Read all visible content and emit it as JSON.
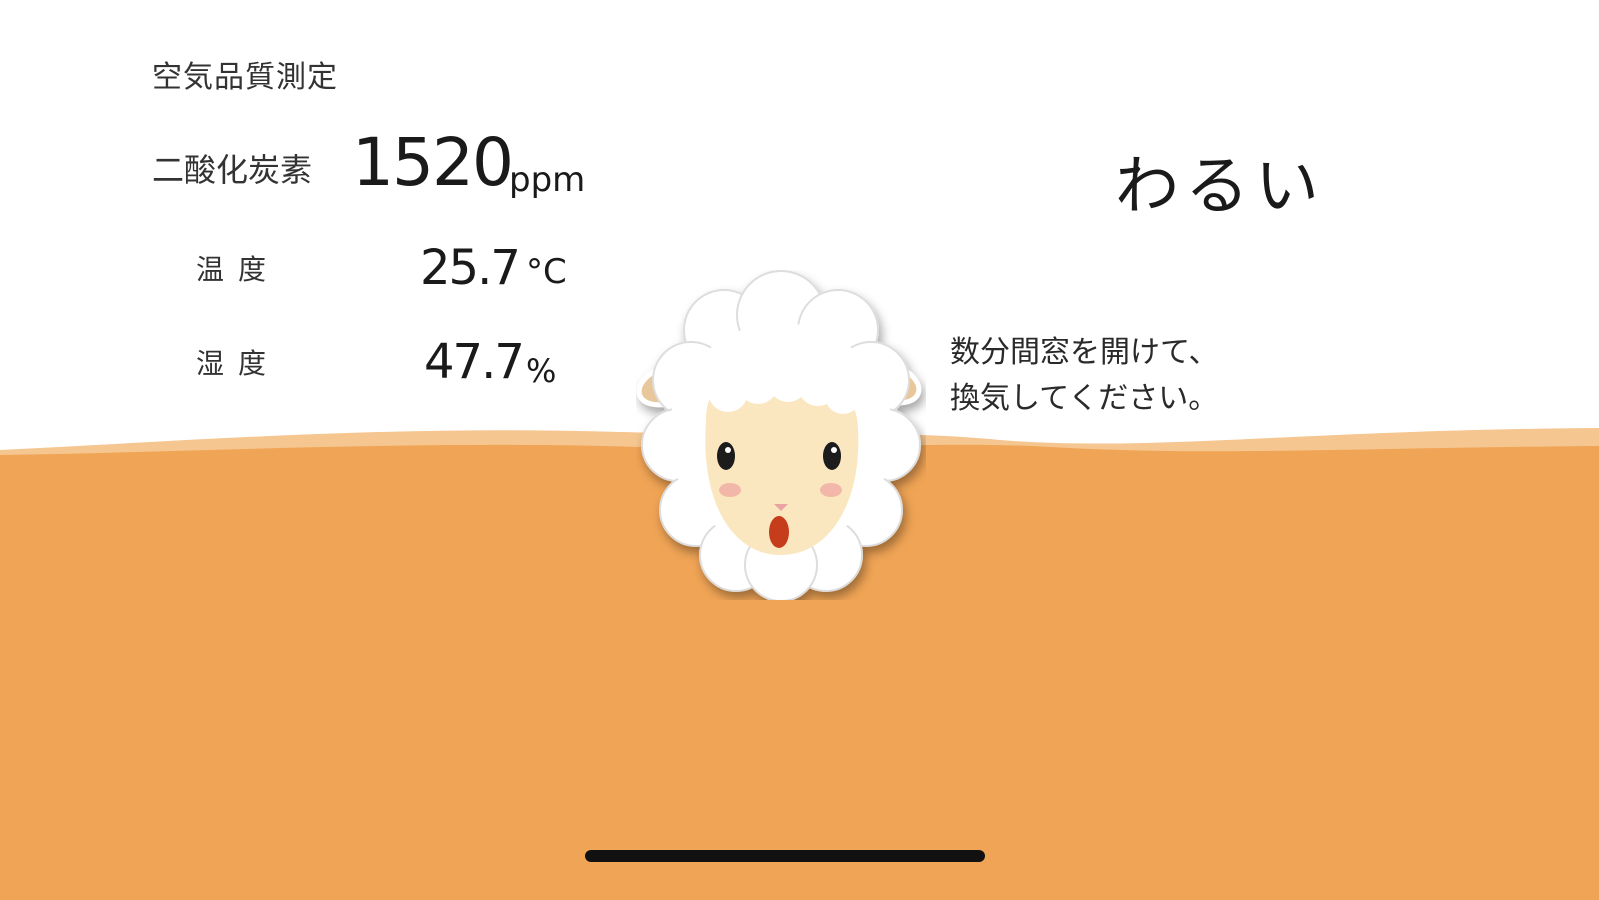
{
  "header": {
    "title": "空気品質測定"
  },
  "readings": {
    "co2": {
      "label": "二酸化炭素",
      "value": "1520",
      "unit": "ppm"
    },
    "temperature": {
      "label": "温度",
      "value": "25.7",
      "unit": "°C"
    },
    "humidity": {
      "label": "湿度",
      "value": "47.7",
      "unit": "%"
    }
  },
  "status": {
    "label": "わるい",
    "advice_line1": "数分間窓を開けて、",
    "advice_line2": "換気してください。"
  },
  "mascot": {
    "icon": "sheep-face-icon"
  },
  "colors": {
    "accent": "#f0a455",
    "wave_light": "#f5c690",
    "text": "#1a1a1a"
  }
}
